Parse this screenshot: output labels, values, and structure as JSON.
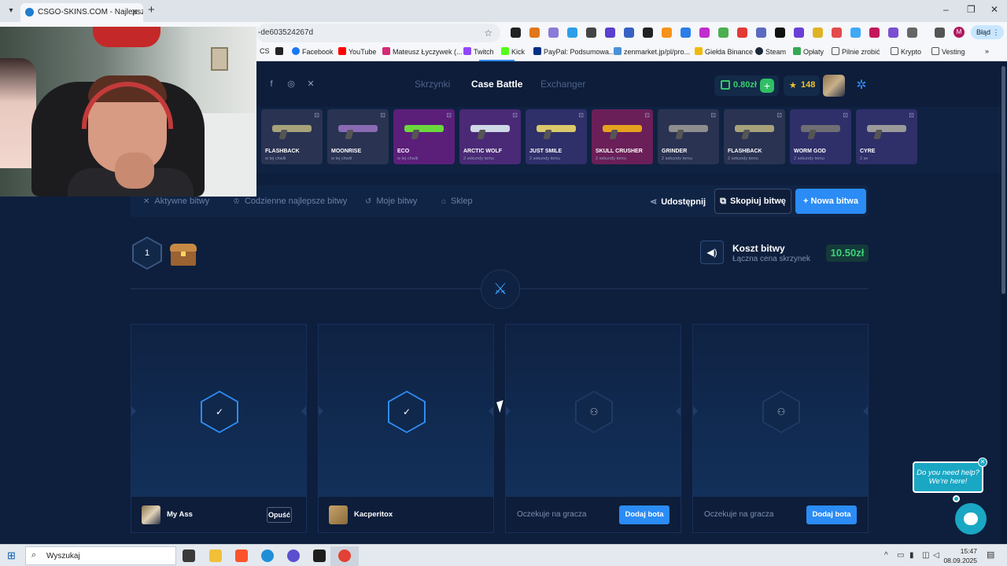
{
  "browser": {
    "tab_title": "CSGO-SKINS.COM - Najlepsze",
    "url": "-de603524267d",
    "error_chip": "Błąd",
    "profile_letter": "M",
    "bookmarks": [
      "CS",
      "Facebook",
      "YouTube",
      "Mateusz Łyczywek (...",
      "Twitch",
      "Kick",
      "PayPal: Podsumowa...",
      "zenmarket.jp/pl/pro...",
      "Giełda Binance",
      "Steam",
      "Opłaty",
      "Pilnie zrobić",
      "Krypto",
      "Vesting"
    ]
  },
  "site": {
    "nav": [
      "Skrzynki",
      "Case Battle",
      "Exchanger"
    ],
    "active_nav": "Case Battle",
    "balance": "0.80zł",
    "points": "148"
  },
  "drops": [
    {
      "name": "FLASHBACK",
      "time": "w tej chwili",
      "bg": "#2a3352",
      "color": "#a8a27a"
    },
    {
      "name": "MOONRISE",
      "time": "w tej chwili",
      "bg": "#2a3352",
      "color": "#8b6ab4"
    },
    {
      "name": "ECO",
      "time": "w tej chwili",
      "bg": "#5b1f7a",
      "color": "#6bd83c"
    },
    {
      "name": "ARCTIC WOLF",
      "time": "2 sekundy temu",
      "bg": "#4a2a76",
      "color": "#cfd8e6"
    },
    {
      "name": "JUST SMILE",
      "time": "2 sekundy temu",
      "bg": "#2f2f6a",
      "color": "#d9c96a"
    },
    {
      "name": "SKULL CRUSHER",
      "time": "2 sekundy temu",
      "bg": "#6a1f58",
      "color": "#e6a21e"
    },
    {
      "name": "GRINDER",
      "time": "2 sekundy temu",
      "bg": "#2a3352",
      "color": "#8e8e8e"
    },
    {
      "name": "FLASHBACK",
      "time": "2 sekundy temu",
      "bg": "#2a3352",
      "color": "#a8a27a"
    },
    {
      "name": "WORM GOD",
      "time": "2 sekundy temu",
      "bg": "#2f2f6a",
      "color": "#6e6e74"
    },
    {
      "name": "CYRE",
      "time": "2 se",
      "bg": "#2f2f6a",
      "color": "#9a9a9a"
    }
  ],
  "subnav": {
    "items": [
      "Aktywne bitwy",
      "Codzienne najlepsze bitwy",
      "Moje bitwy",
      "Sklep"
    ],
    "share": "Udostępnij",
    "copy": "Skopiuj bitwę",
    "new": "+ Nowa bitwa"
  },
  "battle": {
    "round": "1",
    "cost_title": "Koszt bitwy",
    "cost_sub": "Łączna cena skrzynek",
    "cost_value": "10.50zł"
  },
  "players": [
    {
      "name": "My Ass",
      "leave": "Opuść",
      "state": "ready"
    },
    {
      "name": "Kacperitox",
      "state": "ready"
    },
    {
      "waiting": "Oczekuje na gracza",
      "bot": "Dodaj bota",
      "state": "waiting"
    },
    {
      "waiting": "Oczekuje na gracza",
      "bot": "Dodaj bota",
      "state": "waiting"
    }
  ],
  "chat": {
    "line1": "Do you need help?",
    "line2": "We're here!"
  },
  "taskbar": {
    "search": "Wyszukaj",
    "time": "15:47",
    "date": "08.09.2025"
  }
}
